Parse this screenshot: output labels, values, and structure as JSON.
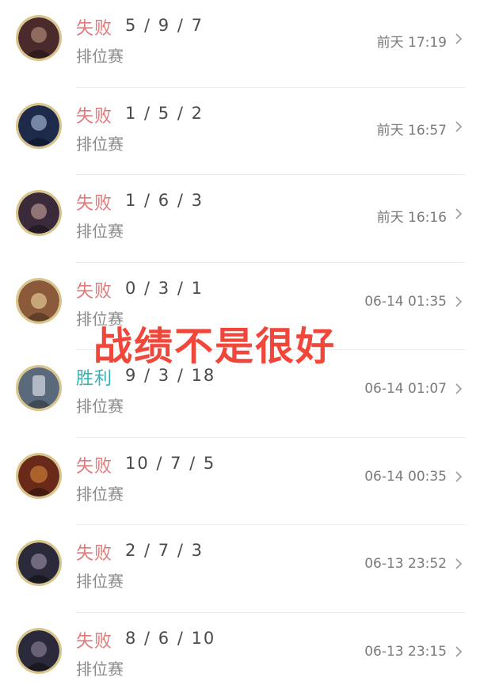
{
  "matches": [
    {
      "result": "失败",
      "outcome": "loss",
      "kda": "5 / 9 / 7",
      "mode": "排位赛",
      "time": "前天 17:19",
      "avatar_color": "#4a2a2a",
      "avatar_icon": "champion-portrait-icon"
    },
    {
      "result": "失败",
      "outcome": "loss",
      "kda": "1 / 5 / 2",
      "mode": "排位赛",
      "time": "前天 16:57",
      "avatar_color": "#1d2a4a",
      "avatar_icon": "champion-portrait-icon"
    },
    {
      "result": "失败",
      "outcome": "loss",
      "kda": "1 / 6 / 3",
      "mode": "排位赛",
      "time": "前天 16:16",
      "avatar_color": "#3a2a3a",
      "avatar_icon": "champion-portrait-icon"
    },
    {
      "result": "失败",
      "outcome": "loss",
      "kda": "0 / 3 / 1",
      "mode": "排位赛",
      "time": "06-14 01:35",
      "avatar_color": "#8a5a3a",
      "avatar_icon": "champion-portrait-icon"
    },
    {
      "result": "胜利",
      "outcome": "win",
      "kda": "9 / 3 / 18",
      "mode": "排位赛",
      "time": "06-14 01:07",
      "avatar_color": "#5a6a7a",
      "avatar_icon": "champion-portrait-icon"
    },
    {
      "result": "失败",
      "outcome": "loss",
      "kda": "10 / 7 / 5",
      "mode": "排位赛",
      "time": "06-14 00:35",
      "avatar_color": "#6a2a1a",
      "avatar_icon": "champion-portrait-icon"
    },
    {
      "result": "失败",
      "outcome": "loss",
      "kda": "2 / 7 / 3",
      "mode": "排位赛",
      "time": "06-13 23:52",
      "avatar_color": "#2a2a3a",
      "avatar_icon": "champion-portrait-icon"
    },
    {
      "result": "失败",
      "outcome": "loss",
      "kda": "8 / 6 / 10",
      "mode": "排位赛",
      "time": "06-13 23:15",
      "avatar_color": "#2a2a3a",
      "avatar_icon": "champion-portrait-icon"
    }
  ],
  "overlay_caption": "战绩不是很好",
  "colors": {
    "loss": "#e07a7a",
    "win": "#2fb3b3",
    "overlay": "#f0473a"
  },
  "row_icon": "chevron-right-icon"
}
